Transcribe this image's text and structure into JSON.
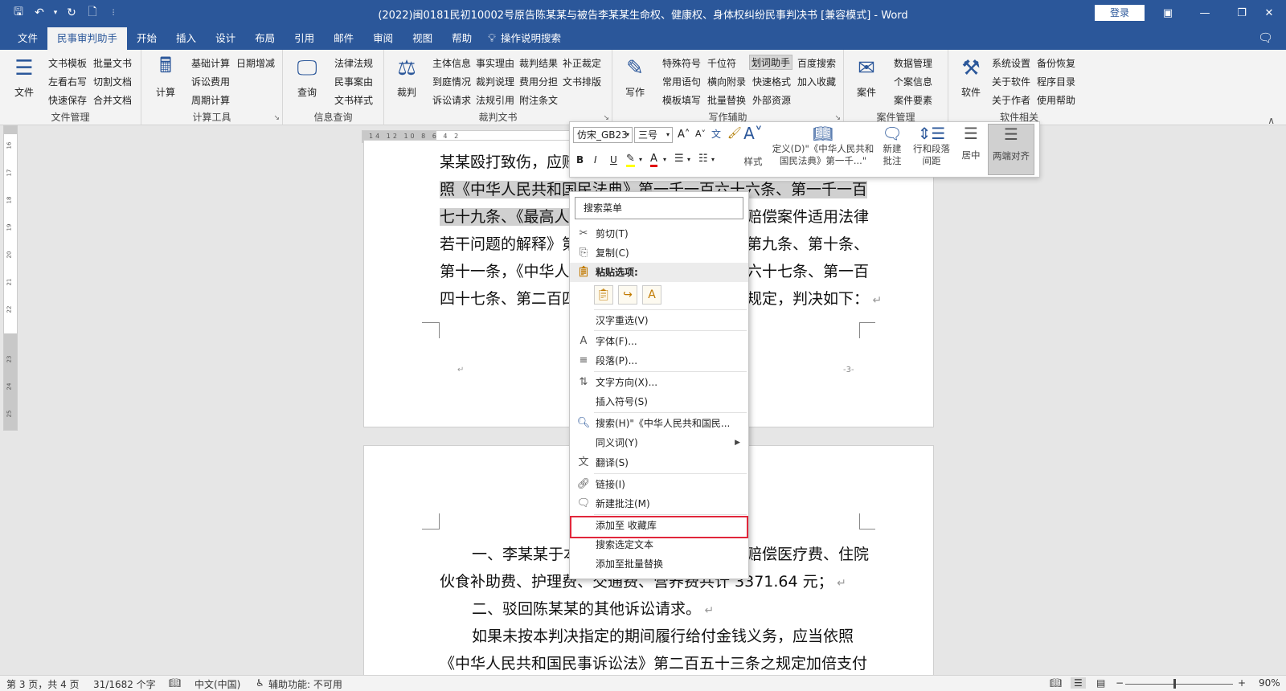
{
  "titlebar": {
    "title": "(2022)闽0181民初10002号原告陈某某与被告李某某生命权、健康权、身体权纠纷民事判决书 [兼容模式]  -  Word",
    "login": "登录"
  },
  "tabs": [
    "文件",
    "民事审判助手",
    "开始",
    "插入",
    "设计",
    "布局",
    "引用",
    "邮件",
    "审阅",
    "视图",
    "帮助"
  ],
  "tell_me": "操作说明搜索",
  "ribbon": {
    "g1": {
      "label": "文件管理",
      "big": "文件",
      "items": [
        "文书模板",
        "批量文书",
        "左看右写",
        "切割文档",
        "快速保存",
        "合并文档"
      ]
    },
    "g2": {
      "label": "计算工具",
      "big": "计算",
      "items": [
        "基础计算",
        "日期增减",
        "诉讼费用",
        "周期计算"
      ]
    },
    "g3": {
      "label": "信息查询",
      "big": "查询",
      "items": [
        "法律法规",
        "民事案由",
        "文书样式"
      ]
    },
    "g4": {
      "label": "裁判文书",
      "big": "裁判",
      "items": [
        "主体信息",
        "事实理由",
        "裁判结果",
        "补正裁定",
        "到庭情况",
        "裁判说理",
        "费用分担",
        "文书排版",
        "诉讼请求",
        "法规引用",
        "附注条文"
      ]
    },
    "g5": {
      "label": "写作辅助",
      "big": "写作",
      "items": [
        "特殊符号",
        "千位符",
        "划词助手",
        "百度搜索",
        "常用语句",
        "横向附录",
        "快速格式",
        "加入收藏",
        "模板填写",
        "批量替换",
        "外部资源"
      ]
    },
    "g6": {
      "label": "案件管理",
      "big": "案件",
      "items": [
        "数据管理",
        "个案信息",
        "案件要素"
      ]
    },
    "g7": {
      "label": "软件相关",
      "big": "软件",
      "items": [
        "系统设置",
        "备份恢复",
        "关于软件",
        "程序目录",
        "关于作者",
        "使用帮助"
      ]
    }
  },
  "ruler": {
    "h": "14  12  10  8  6  4  2",
    "v": [
      "16",
      "17",
      "18",
      "19",
      "20",
      "21",
      "22",
      "23",
      "24",
      "25"
    ]
  },
  "document": {
    "page1_lines": [
      "某某殴打致伤，应赔",
      "照《中华人民共和国民法典》第一千一百六十六条、第一千一百",
      "七十九条、《最高人",
      "若干问题的解释》第",
      "第十一条，《中华人",
      "四十七条、第二百四"
    ],
    "page1_right": [
      "",
      "",
      "赔偿案件适用法律",
      "第九条、第十条、",
      "六十七条、第一百",
      "规定，判决如下："
    ],
    "page_num": "-3-",
    "page2_lines": [
      "一、李某某于本",
      "伙食补助费、护理费、交通费、营养费共计 3371.64 元；",
      "二、驳回陈某某的其他诉讼请求。",
      "如果未按本判决指定的期间履行给付金钱义务，应当依照",
      "《中华人民共和国民事诉讼法》第二百五十三条之规定加倍支付"
    ],
    "page2_right": "赔偿医疗费、住院"
  },
  "mini_toolbar": {
    "font": "仿宋_GB23",
    "size": "三号",
    "styles": "样式",
    "define": "定义(D)\"《中华人民共和国民法典》第一千...\"",
    "new_comment": "新建批注",
    "line_spacing": "行和段落间距",
    "center": "居中",
    "justify": "两端对齐"
  },
  "context_menu": {
    "search": "搜索菜单",
    "items": [
      "剪切(T)",
      "复制(C)",
      "粘贴选项:",
      "汉字重选(V)",
      "字体(F)...",
      "段落(P)...",
      "文字方向(X)...",
      "插入符号(S)",
      "搜索(H)\"《中华人民共和国民...",
      "同义词(Y)",
      "翻译(S)",
      "链接(I)",
      "新建批注(M)",
      "添加至 收藏库",
      "搜索选定文本",
      "添加至批量替换"
    ]
  },
  "statusbar": {
    "page": "第 3 页，共 4 页",
    "words": "31/1682 个字",
    "lang": "中文(中国)",
    "accessibility": "辅助功能: 不可用",
    "zoom": "90%"
  },
  "colors": {
    "brand": "#2b579a",
    "highlight_box": "#e1273b"
  }
}
